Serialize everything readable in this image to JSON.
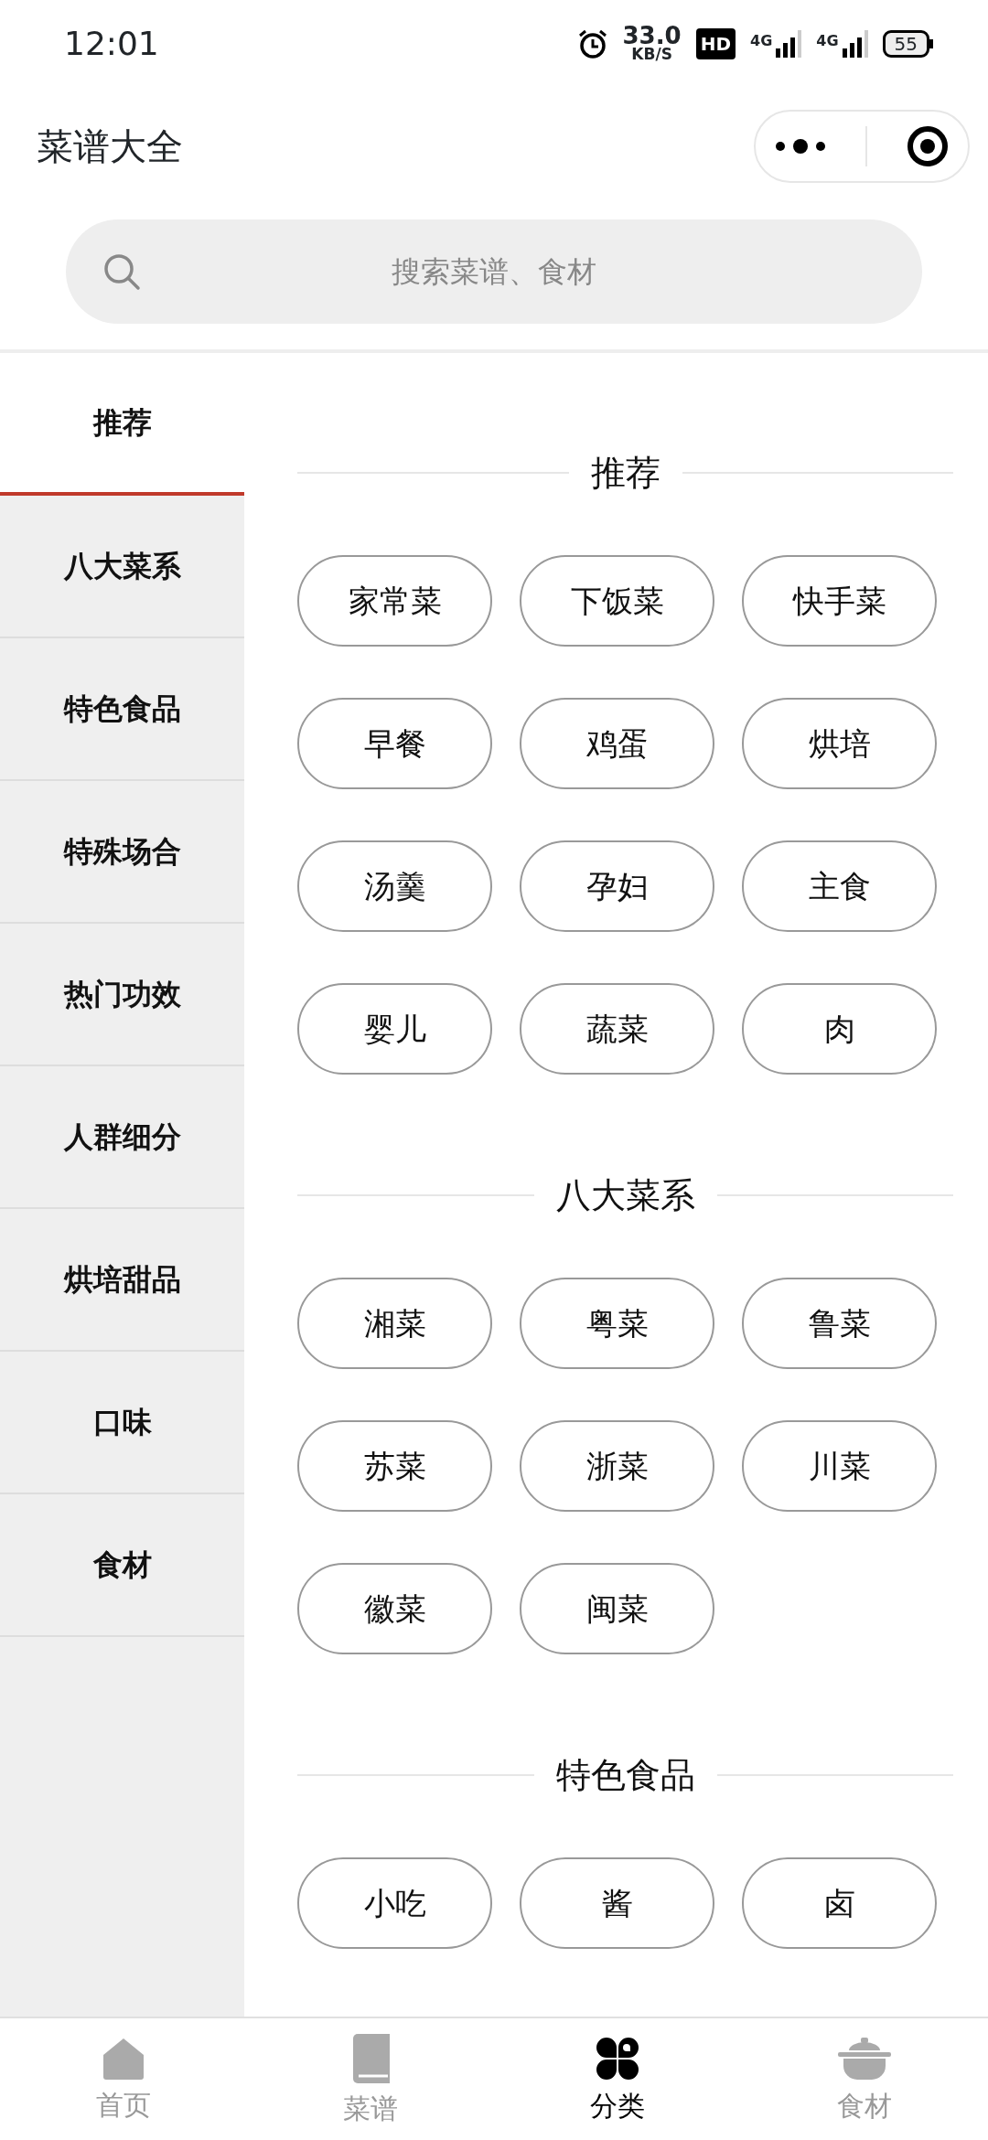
{
  "status_bar": {
    "time": "12:01",
    "speed_value": "33.0",
    "speed_unit": "KB/S",
    "hd": "HD",
    "sims": [
      "4G",
      "4G"
    ],
    "battery": "55"
  },
  "header": {
    "title": "菜谱大全"
  },
  "search": {
    "placeholder": "搜索菜谱、食材"
  },
  "sidebar": {
    "items": [
      {
        "label": "推荐",
        "selected": true
      },
      {
        "label": "八大菜系",
        "selected": false
      },
      {
        "label": "特色食品",
        "selected": false
      },
      {
        "label": "特殊场合",
        "selected": false
      },
      {
        "label": "热门功效",
        "selected": false
      },
      {
        "label": "人群细分",
        "selected": false
      },
      {
        "label": "烘培甜品",
        "selected": false
      },
      {
        "label": "口味",
        "selected": false
      },
      {
        "label": "食材",
        "selected": false
      }
    ]
  },
  "sections": [
    {
      "title": "推荐",
      "tags": [
        "家常菜",
        "下饭菜",
        "快手菜",
        "早餐",
        "鸡蛋",
        "烘培",
        "汤羹",
        "孕妇",
        "主食",
        "婴儿",
        "蔬菜",
        "肉"
      ]
    },
    {
      "title": "八大菜系",
      "tags": [
        "湘菜",
        "粤菜",
        "鲁菜",
        "苏菜",
        "浙菜",
        "川菜",
        "徽菜",
        "闽菜"
      ]
    },
    {
      "title": "特色食品",
      "tags": [
        "小吃",
        "酱",
        "卤"
      ]
    }
  ],
  "tab_bar": {
    "items": [
      {
        "label": "首页",
        "kind": "home",
        "selected": false
      },
      {
        "label": "菜谱",
        "kind": "book",
        "selected": false
      },
      {
        "label": "分类",
        "kind": "category",
        "selected": true
      },
      {
        "label": "食材",
        "kind": "pot",
        "selected": false
      }
    ]
  }
}
